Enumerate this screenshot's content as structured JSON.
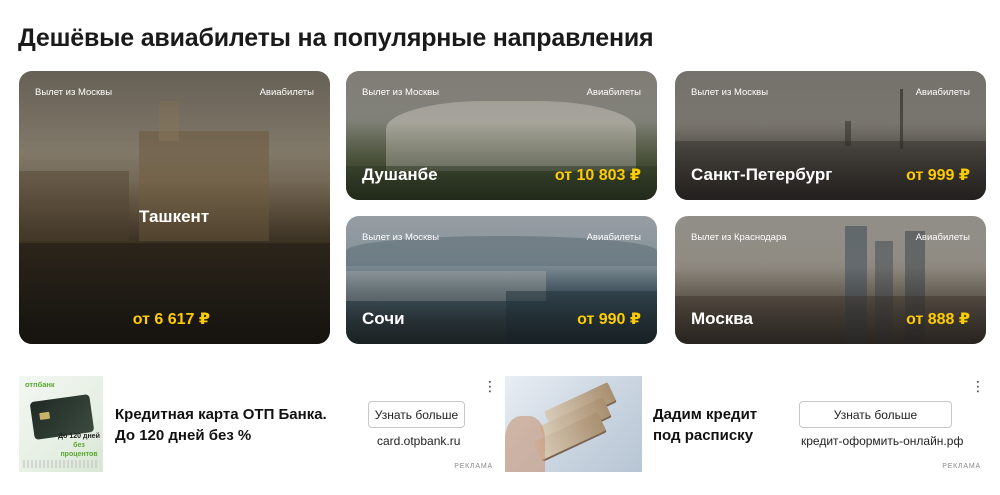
{
  "heading": "Дешёвые авиабилеты на популярные направления",
  "cards": [
    {
      "from": "Вылет из Москвы",
      "kind": "Авиабилеты",
      "city": "Ташкент",
      "price": "от 6 617 ₽"
    },
    {
      "from": "Вылет из Москвы",
      "kind": "Авиабилеты",
      "city": "Душанбе",
      "price": "от 10 803 ₽"
    },
    {
      "from": "Вылет из Москвы",
      "kind": "Авиабилеты",
      "city": "Санкт-Петербург",
      "price": "от 999 ₽"
    },
    {
      "from": "Вылет из Москвы",
      "kind": "Авиабилеты",
      "city": "Сочи",
      "price": "от 990 ₽"
    },
    {
      "from": "Вылет из Краснодара",
      "kind": "Авиабилеты",
      "city": "Москва",
      "price": "от 888 ₽"
    }
  ],
  "ads": [
    {
      "brand": "отпбанк",
      "promo_line1": "До 120 дней",
      "promo_line2": "без процентов",
      "title_line1": "Кредитная карта ОТП Банка.",
      "title_line2": "До 120 дней без %",
      "button": "Узнать больше",
      "domain": "card.otpbank.ru",
      "menu_icon": "⋮",
      "label": "РЕКЛАМА"
    },
    {
      "title_line1": "Дадим кредит",
      "title_line2": "под расписку",
      "button": "Узнать больше",
      "domain": "кредит-оформить-онлайн.рф",
      "menu_icon": "⋮",
      "label": "РЕКЛАМА"
    }
  ],
  "colors": {
    "price": "#ffcc00",
    "otp_green": "#5aa832"
  }
}
